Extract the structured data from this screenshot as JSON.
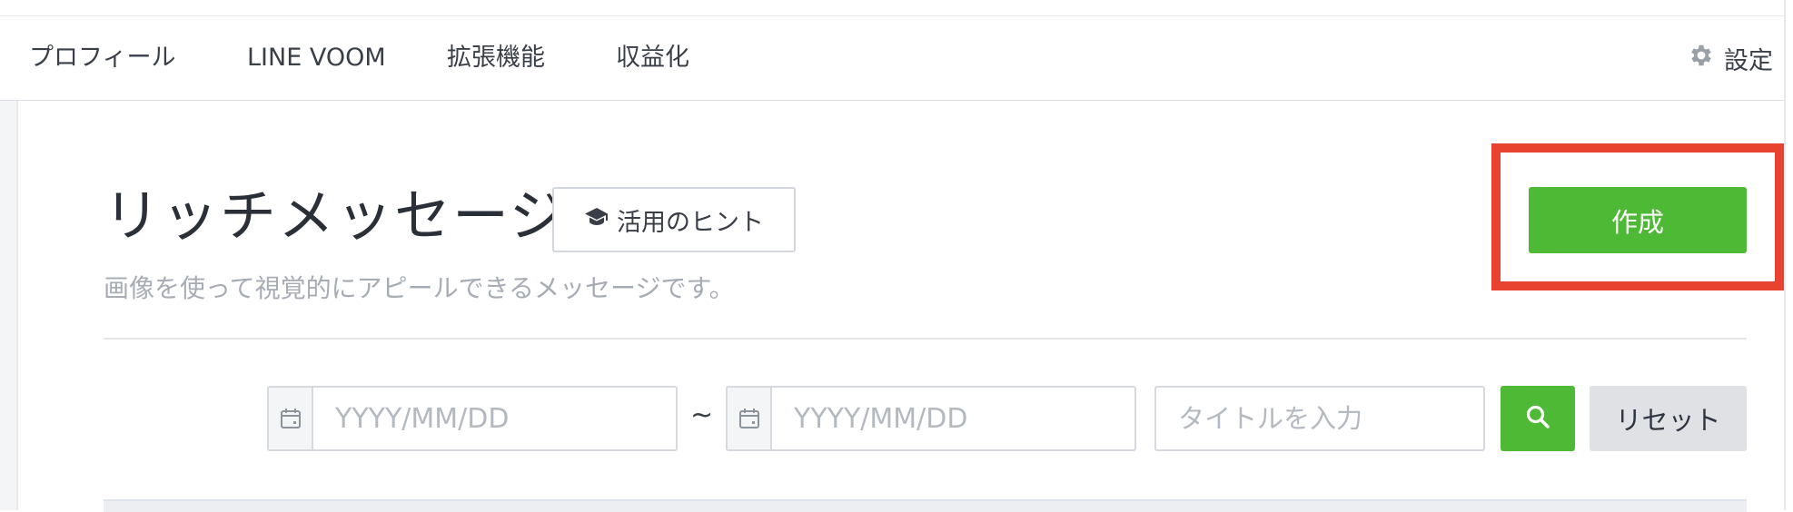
{
  "nav": {
    "items": [
      {
        "label": "プロフィール"
      },
      {
        "label": "LINE VOOM"
      },
      {
        "label": "拡張機能"
      },
      {
        "label": "収益化"
      }
    ],
    "settings_label": "設定"
  },
  "header": {
    "title": "リッチメッセージ",
    "hint_button": "活用のヒント",
    "subtitle": "画像を使って視覚的にアピールできるメッセージです。",
    "create_button": "作成"
  },
  "filters": {
    "start_date_placeholder": "YYYY/MM/DD",
    "end_date_placeholder": "YYYY/MM/DD",
    "separator": "~",
    "title_placeholder": "タイトルを入力",
    "reset_button": "リセット"
  },
  "colors": {
    "accent_green": "#4db935",
    "highlight_red": "#e84330"
  }
}
